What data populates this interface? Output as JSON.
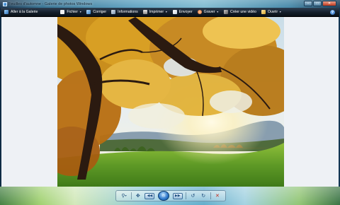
{
  "window": {
    "title": "Feuilles d'automne - Galerie de photos Windows",
    "controls": {
      "minimize": "–",
      "maximize": "□",
      "close": "✕"
    }
  },
  "toolbar": {
    "back_label": "Aller à la Galerie",
    "items": [
      {
        "label": "Fichier",
        "has_menu": true,
        "icon": "file-icon"
      },
      {
        "label": "Corriger",
        "has_menu": false,
        "icon": "fix-icon"
      },
      {
        "label": "Informations",
        "has_menu": false,
        "icon": "info-icon"
      },
      {
        "label": "Imprimer",
        "has_menu": true,
        "icon": "printer-icon"
      },
      {
        "label": "Envoyer",
        "has_menu": false,
        "icon": "email-icon"
      },
      {
        "label": "Graver",
        "has_menu": true,
        "icon": "burn-disc-icon"
      },
      {
        "label": "Créer une vidéo",
        "has_menu": false,
        "icon": "movie-icon"
      },
      {
        "label": "Ouvrir",
        "has_menu": true,
        "icon": "open-icon"
      }
    ],
    "help_glyph": "?"
  },
  "viewer": {
    "image_subject": "autumn oak tree over green meadow at sunrise"
  },
  "controls": {
    "zoom_glyph": "⚲",
    "zoom_caret": "▾",
    "fit_glyph": "✥",
    "prev_glyph": "◀◀",
    "slideshow_glyph": "▭",
    "next_glyph": "▶▶",
    "rotate_ccw_glyph": "↺",
    "rotate_cw_glyph": "↻",
    "delete_glyph": "✕"
  },
  "colors": {
    "toolbar_bg": "#141e2a",
    "viewer_bg": "#eef1f5",
    "accent_blue": "#2c75c8",
    "delete_red": "#c22a1a"
  }
}
